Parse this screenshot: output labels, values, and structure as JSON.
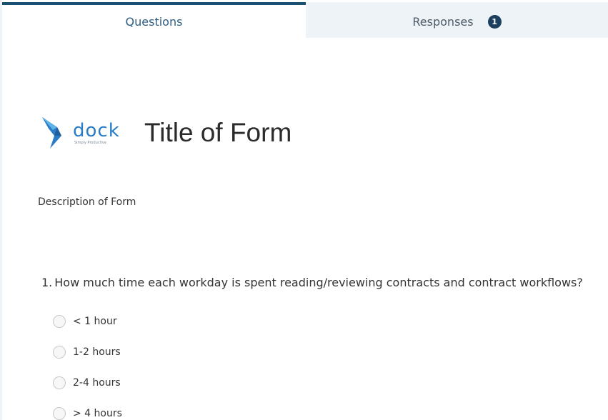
{
  "tabs": {
    "questions_label": "Questions",
    "responses_label": "Responses",
    "responses_count": "1"
  },
  "colors": {
    "accent": "#1b4f72",
    "badge": "#1c3f5e",
    "tab_inactive_bg": "#eef3f8",
    "logo_blue": "#2a7cc7"
  },
  "form": {
    "logo_word": "dock",
    "logo_tagline": "Simply Productive",
    "title": "Title of Form",
    "description": "Description of Form"
  },
  "question": {
    "number": "1.",
    "text": "How much time each workday is spent reading/reviewing contracts and contract workflows?",
    "options": [
      "< 1 hour",
      "1-2 hours",
      "2-4 hours",
      "> 4 hours"
    ]
  }
}
